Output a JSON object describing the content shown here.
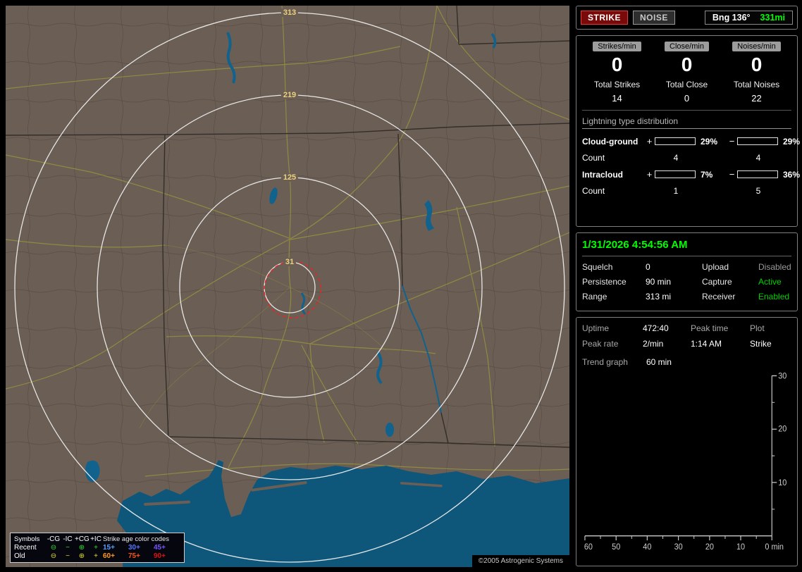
{
  "map": {
    "ring_labels": [
      "313",
      "219",
      "125",
      "31"
    ],
    "copyright": "©2005 Astrogenic Systems",
    "legend": {
      "symbols_header": "Symbols",
      "type_headers": [
        "-CG",
        "-IC",
        "+CG",
        "+IC"
      ],
      "age_header": "Strike age color codes",
      "rows": [
        {
          "label": "Recent",
          "color": "#33dd33",
          "symbols": [
            "⊖",
            "−",
            "⊕",
            "+"
          ],
          "ages": [
            {
              "text": "15+",
              "color": "#55a0ff"
            },
            {
              "text": "30+",
              "color": "#5577ff"
            },
            {
              "text": "45+",
              "color": "#7755ff"
            }
          ]
        },
        {
          "label": "Old",
          "color": "#dddd33",
          "symbols": [
            "⊖",
            "−",
            "⊕",
            "+"
          ],
          "ages": [
            {
              "text": "60+",
              "color": "#ff9922"
            },
            {
              "text": "75+",
              "color": "#ff5511"
            },
            {
              "text": "90+",
              "color": "#e01010"
            }
          ]
        }
      ]
    }
  },
  "sidebar": {
    "top": {
      "strike": "STRIKE",
      "noise": "NOISE",
      "bearing": "Bng 136°",
      "range": "331mi"
    },
    "rates": [
      {
        "header": "Strikes/min",
        "value": "0",
        "total_label": "Total Strikes",
        "total_value": "14"
      },
      {
        "header": "Close/min",
        "value": "0",
        "total_label": "Total Close",
        "total_value": "0"
      },
      {
        "header": "Noises/min",
        "value": "0",
        "total_label": "Total Noises",
        "total_value": "22"
      }
    ],
    "dist": {
      "title": "Lightning type distribution",
      "rows": [
        {
          "label": "Cloud-ground",
          "plus": "+",
          "minus": "−",
          "pos_pct": "29%",
          "pos_fill": "58%",
          "pos_color": "#ff2020",
          "neg_pct": "29%",
          "neg_fill": "58%",
          "neg_color": "#6aa8ff",
          "count_label": "Count",
          "pos_count": "4",
          "neg_count": "4"
        },
        {
          "label": "Intracloud",
          "plus": "+",
          "minus": "−",
          "pos_pct": "7%",
          "pos_fill": "14%",
          "pos_color": "#ff80ff",
          "neg_pct": "36%",
          "neg_fill": "72%",
          "neg_color": "#22cc22",
          "count_label": "Count",
          "pos_count": "1",
          "neg_count": "5"
        }
      ]
    },
    "clock": "1/31/2026 4:54:56 AM",
    "settings": [
      {
        "label": "Squelch",
        "value": "0",
        "label2": "Upload",
        "value2": "Disabled",
        "value2_color": "#9a9a9a"
      },
      {
        "label": "Persistence",
        "value": "90 min",
        "label2": "Capture",
        "value2": "Active",
        "value2_color": "#00d000"
      },
      {
        "label": "Range",
        "value": "313 mi",
        "label2": "Receiver",
        "value2": "Enabled",
        "value2_color": "#00d000"
      }
    ],
    "status": {
      "uptime_label": "Uptime",
      "uptime": "472:40",
      "peak_time_label": "Peak time",
      "peak_time": "1:14 AM",
      "plot_label": "Plot",
      "plot": "Strike",
      "peak_rate_label": "Peak rate",
      "peak_rate": "2/min",
      "trend_label": "Trend graph",
      "trend_value": "60 min"
    },
    "chart": {
      "y_ticks": [
        "30",
        "20",
        "10"
      ],
      "x_ticks": [
        "60",
        "50",
        "40",
        "30",
        "20",
        "10"
      ],
      "x_end_label": "0 min"
    }
  }
}
